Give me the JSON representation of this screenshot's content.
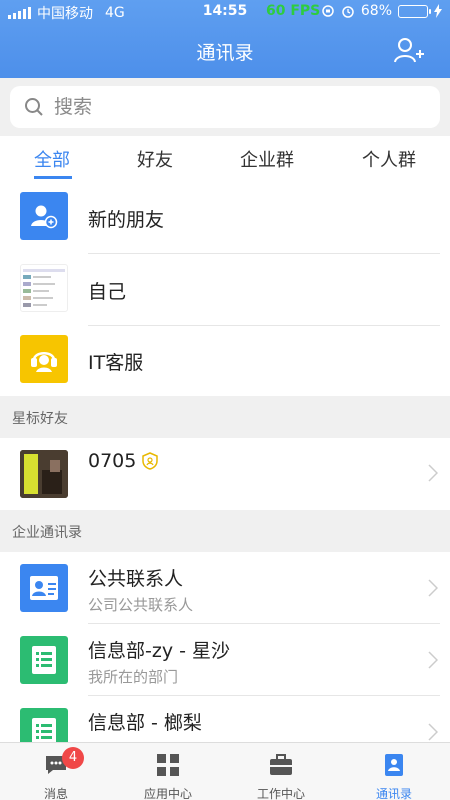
{
  "status": {
    "carrier": "中国移动",
    "network": "4G",
    "time": "14:55",
    "fps": "60 FPS",
    "battery": "68%",
    "battery_level": 0.68
  },
  "nav": {
    "title": "通讯录",
    "add_icon": "add-person-icon"
  },
  "search": {
    "placeholder": "搜索"
  },
  "tabs": [
    {
      "label": "全部",
      "active": true
    },
    {
      "label": "好友"
    },
    {
      "label": "企业群"
    },
    {
      "label": "个人群"
    }
  ],
  "top_items": [
    {
      "title": "新的朋友",
      "icon": "add-person-icon",
      "color": "#3b86f0"
    },
    {
      "title": "自己",
      "icon": "screenshot-thumbnail"
    },
    {
      "title": "IT客服",
      "icon": "headset-icon",
      "color": "#f7c500"
    }
  ],
  "starred": {
    "label": "星标好友",
    "items": [
      {
        "title": "0705",
        "badge_icon": "verified-shield-icon"
      }
    ]
  },
  "enterprise": {
    "label": "企业通讯录",
    "items": [
      {
        "title": "公共联系人",
        "subtitle": "公司公共联系人",
        "icon": "contact-card-icon",
        "color": "#3b86f0"
      },
      {
        "title": "信息部-zy - 星沙",
        "subtitle": "我所在的部门",
        "icon": "department-icon",
        "color": "#2cbc72"
      },
      {
        "title": "信息部 - 榔梨",
        "subtitle": "",
        "icon": "department-icon",
        "color": "#2cbc72"
      }
    ]
  },
  "tabbar": [
    {
      "label": "消息",
      "icon": "message-icon",
      "badge": "4"
    },
    {
      "label": "应用中心",
      "icon": "apps-grid-icon"
    },
    {
      "label": "工作中心",
      "icon": "briefcase-icon"
    },
    {
      "label": "通讯录",
      "icon": "contacts-book-icon",
      "active": true
    }
  ]
}
